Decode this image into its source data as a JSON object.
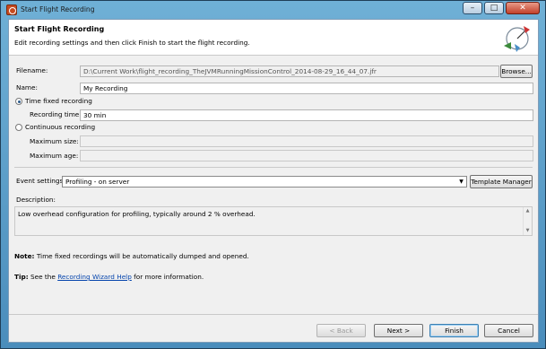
{
  "window": {
    "title": "Start Flight Recording",
    "controls": {
      "minimize": "–",
      "maximize": "□",
      "close": "✕"
    }
  },
  "header": {
    "title": "Start Flight Recording",
    "description": "Edit recording settings and then click Finish to start the flight recording."
  },
  "form": {
    "filename_label": "Filename:",
    "filename_value": "D:\\Current Work\\flight_recording_TheJVMRunningMissionControl_2014-08-29_16_44_07.jfr",
    "browse_label": "Browse...",
    "name_label": "Name:",
    "name_value": "My Recording",
    "time_fixed_label": "Time fixed recording",
    "recording_time_label": "Recording time:",
    "recording_time_value": "30 min",
    "continuous_label": "Continuous recording",
    "max_size_label": "Maximum size:",
    "max_age_label": "Maximum age:",
    "event_settings_label": "Event settings:",
    "event_settings_value": "Profiling - on server",
    "template_manager_label": "Template Manager",
    "description_label": "Description:",
    "description_text": "Low overhead configuration for profiling, typically around 2 % overhead."
  },
  "notes": {
    "note_bold": "Note:",
    "note_text": "Time fixed recordings will be automatically dumped and opened.",
    "tip_bold": "Tip:",
    "tip_pre": "See the",
    "tip_link": "Recording Wizard Help",
    "tip_post": "for more information."
  },
  "buttons": {
    "back": "< Back",
    "next": "Next >",
    "finish": "Finish",
    "cancel": "Cancel"
  },
  "icons": [
    "app-icon",
    "minimize-icon",
    "maximize-icon",
    "close-icon",
    "wizard-banner-icon",
    "dropdown-arrow-icon",
    "scroll-up-icon",
    "scroll-down-icon"
  ]
}
